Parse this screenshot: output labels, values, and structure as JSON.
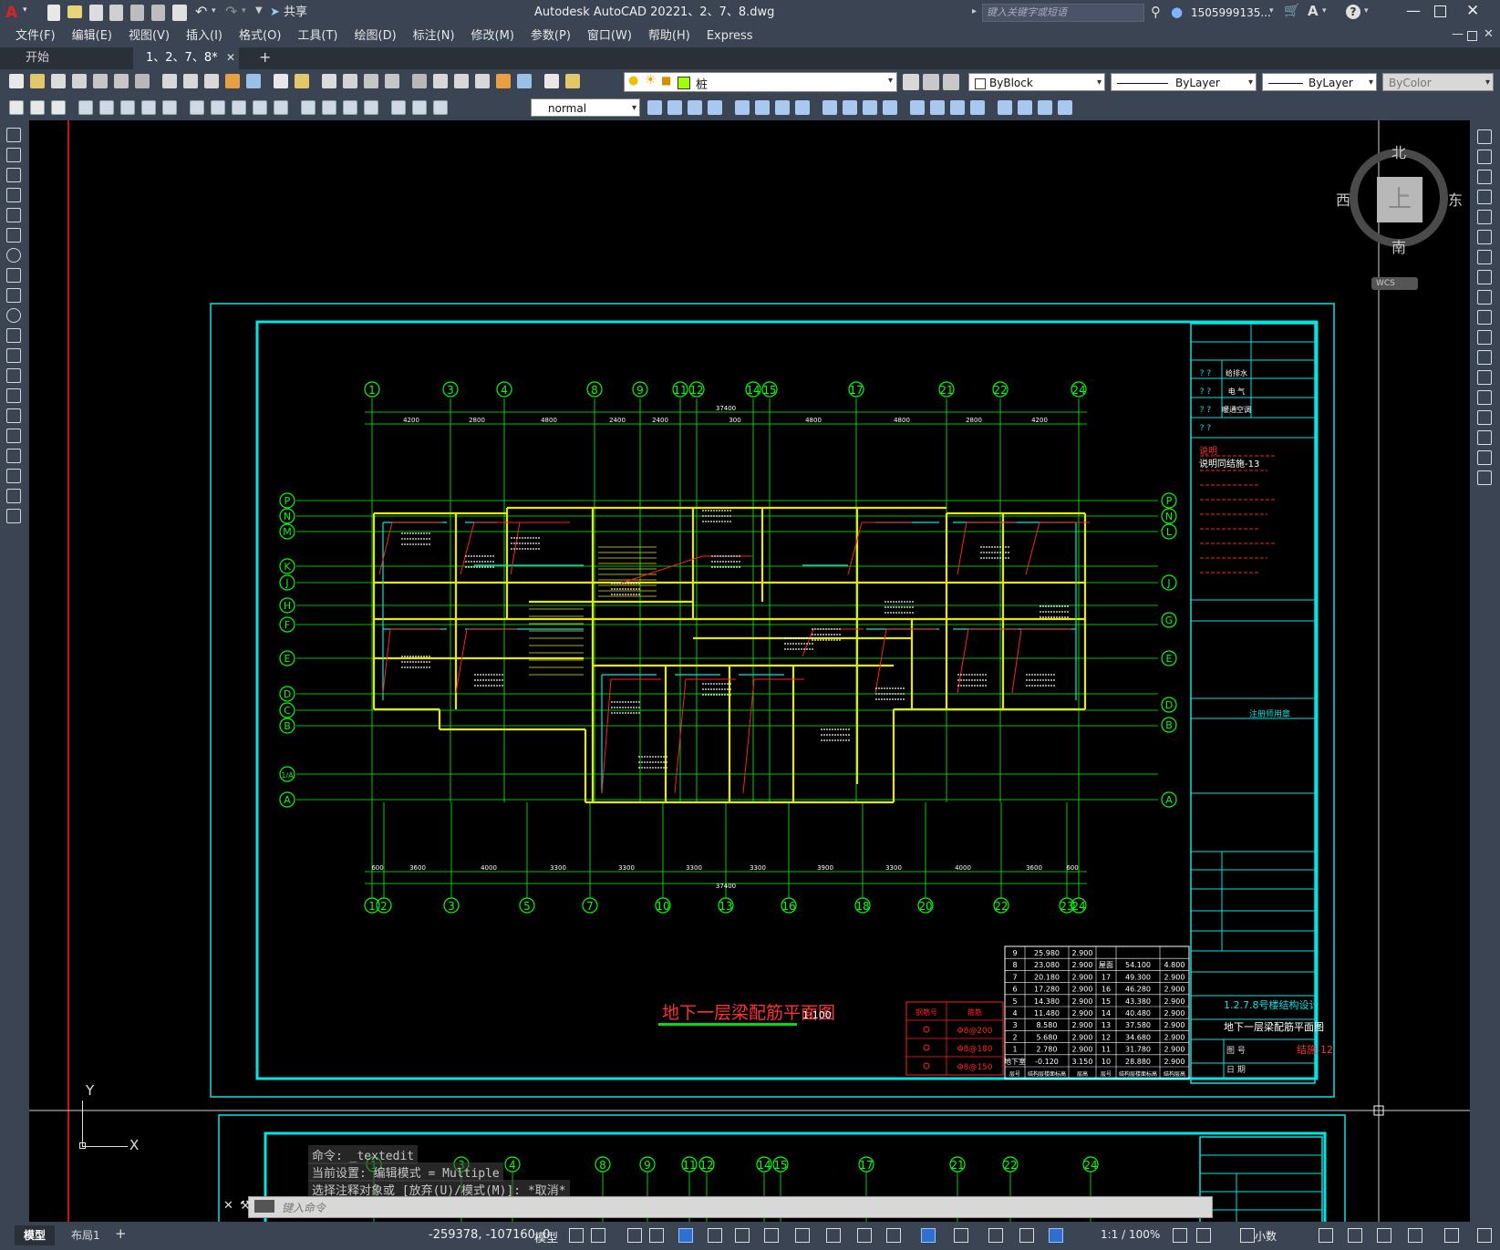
{
  "titlebar": {
    "app_title": "Autodesk AutoCAD 2022",
    "file_name": "1、2、7、8.dwg",
    "share_label": "共享",
    "search_placeholder": "键入关键字或短语",
    "user_name": "1505999135..."
  },
  "menu": {
    "items": [
      "文件(F)",
      "编辑(E)",
      "视图(V)",
      "插入(I)",
      "格式(O)",
      "工具(T)",
      "绘图(D)",
      "标注(N)",
      "修改(M)",
      "参数(P)",
      "窗口(W)",
      "帮助(H)",
      "Express"
    ]
  },
  "tabs": {
    "start": "开始",
    "active_doc": "1、2、7、8*",
    "close": "✕",
    "add": "+"
  },
  "toolbar": {
    "layer_value": "桩",
    "color_value": "ByBlock",
    "linetype_value": "ByLayer",
    "lineweight_value": "ByLayer",
    "plotstyle_value": "ByColor",
    "dimstyle_value": "normal"
  },
  "viewcube": {
    "north": "北",
    "south": "南",
    "east": "东",
    "west": "西",
    "face": "上",
    "wcs": "WCS"
  },
  "drawing": {
    "title": "地下一层梁配筋平面图",
    "scale": "1:100",
    "axes_top": [
      "1",
      "3",
      "4",
      "8",
      "9",
      "11",
      "12",
      "14",
      "15",
      "17",
      "21",
      "22",
      "24"
    ],
    "axes_bottom": [
      "1",
      "2",
      "3",
      "5",
      "7",
      "10",
      "13",
      "16",
      "18",
      "20",
      "22",
      "23",
      "24"
    ],
    "axes_left": [
      "P",
      "N",
      "M",
      "K",
      "J",
      "H",
      "F",
      "E",
      "D",
      "C",
      "B",
      "1/A",
      "A"
    ],
    "axes_right": [
      "P",
      "N",
      "L",
      "J",
      "G",
      "E",
      "D",
      "B",
      "A"
    ],
    "total_dim": "37400",
    "dims_top": [
      "4200",
      "2800",
      "4800",
      "2400",
      "2400",
      "300",
      "4800",
      "4800",
      "2800",
      "4200"
    ],
    "dims_bottom": [
      "600",
      "3600",
      "4000",
      "3300",
      "3300",
      "3300",
      "3300",
      "3900",
      "3300",
      "4000",
      "3600",
      "600"
    ],
    "notes_title": "说明",
    "notes_subtitle": "说明同结施-13",
    "titleblock": {
      "project": "1.2.7.8号楼结构设计",
      "sheet": "地下一层梁配筋平面图",
      "sheet_no": "结施-12",
      "label_drawing": "图 号",
      "label_date": "日 期",
      "row_q": "?  ?",
      "disciplines": [
        "给排水",
        "电 气",
        "暖通空调"
      ],
      "stamp": "注册师用章"
    },
    "floor_table": {
      "rows": [
        [
          "9",
          "25.980",
          "2.900",
          "",
          "",
          ""
        ],
        [
          "8",
          "23.080",
          "2.900",
          "屋面",
          "54.100",
          "4.800"
        ],
        [
          "7",
          "20.180",
          "2.900",
          "17",
          "49.300",
          "2.900"
        ],
        [
          "6",
          "17.280",
          "2.900",
          "16",
          "46.280",
          "2.900"
        ],
        [
          "5",
          "14.380",
          "2.900",
          "15",
          "43.380",
          "2.900"
        ],
        [
          "4",
          "11.480",
          "2.900",
          "14",
          "40.480",
          "2.900"
        ],
        [
          "3",
          "8.580",
          "2.900",
          "13",
          "37.580",
          "2.900"
        ],
        [
          "2",
          "5.680",
          "2.900",
          "12",
          "34.680",
          "2.900"
        ],
        [
          "1",
          "2.780",
          "2.900",
          "11",
          "31.780",
          "2.900"
        ],
        [
          "地下室",
          "-0.120",
          "3.150",
          "10",
          "28.880",
          "2.900"
        ]
      ],
      "footer": [
        "层号",
        "结构层楼面标高",
        "层高",
        "层号",
        "结构层楼面标高",
        "结构层高"
      ]
    },
    "red_table": {
      "headers": [
        "钢筋号",
        "箍筋"
      ],
      "rows": [
        "Φ8@200",
        "Φ8@180",
        "Φ8@150"
      ]
    }
  },
  "command": {
    "line1": "命令: _textedit",
    "line2": "当前设置: 编辑模式 = Multiple",
    "line3": "选择注释对象或 [放弃(U)/模式(M)]: *取消*",
    "prompt_placeholder": "键入命令"
  },
  "ucs": {
    "x": "X",
    "y": "Y"
  },
  "status": {
    "tab_model": "模型",
    "tab_layout": "布局1",
    "add": "+",
    "coords": "-259378, -107160, 0",
    "model": "模型",
    "scale": "1:1 / 100%",
    "units": "小数"
  },
  "colors": {
    "frame_cyan": "#00e5e5",
    "axis_green": "#00ff00",
    "beam_yellow": "#e8e800",
    "rebar_red": "#ff2020",
    "ui_panel": "#3b4453"
  }
}
